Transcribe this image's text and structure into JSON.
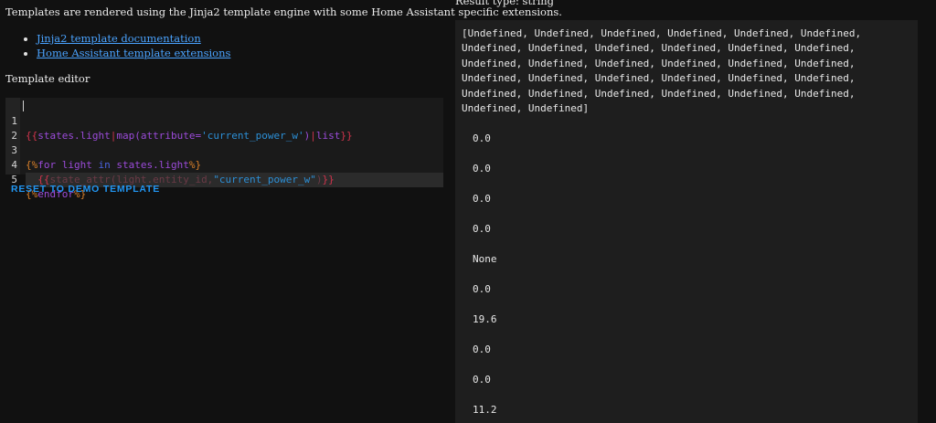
{
  "intro": {
    "text": "Templates are rendered using the Jinja2 template engine with some Home Assistant specific extensions."
  },
  "links": [
    {
      "label": "Jinja2 template documentation"
    },
    {
      "label": "Home Assistant template extensions"
    }
  ],
  "editor": {
    "label": "Template editor",
    "lines": [
      {
        "number": "1",
        "text": "{{states.light|map(attribute='current_power_w')|list}}"
      },
      {
        "number": "2",
        "text": ""
      },
      {
        "number": "3",
        "text": "{%for light in states.light%}"
      },
      {
        "number": "4",
        "text": "  {{state_attr(light.entity_id,\"current_power_w\")}}"
      },
      {
        "number": "5",
        "text": "{%endfor%}"
      }
    ],
    "reset_label": "RESET TO DEMO TEMPLATE"
  },
  "result": {
    "type_label": "Result type: string",
    "list_text": "[Undefined, Undefined, Undefined, Undefined, Undefined, Undefined, Undefined, Undefined, Undefined, Undefined, Undefined, Undefined, Undefined, Undefined, Undefined, Undefined, Undefined, Undefined, Undefined, Undefined, Undefined, Undefined, Undefined, Undefined, Undefined, Undefined, Undefined, Undefined, Undefined, Undefined, Undefined, Undefined]",
    "values": [
      "0.0",
      "0.0",
      "0.0",
      "0.0",
      "None",
      "0.0",
      "19.6",
      "0.0",
      "0.0",
      "11.2"
    ]
  }
}
